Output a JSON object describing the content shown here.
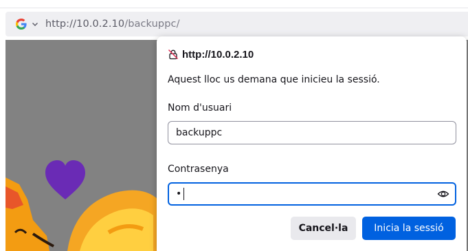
{
  "urlbar": {
    "search_engine": "google-icon",
    "url_host": "http://10.0.2.10",
    "url_path": "/backuppc/"
  },
  "dialog": {
    "site": "http://10.0.2.10",
    "message": "Aquest lloc us demana que inicieu la sessió.",
    "username_label": "Nom d'usuari",
    "username_value": "backuppc",
    "password_label": "Contrasenya",
    "password_value": "•",
    "cancel_label": "Cancel·la",
    "login_label": "Inicia la sessió"
  },
  "colors": {
    "accent": "#0061e0",
    "background_overlay": "#828282",
    "heart": "#6a2bb5",
    "fox": "#f39c12"
  }
}
